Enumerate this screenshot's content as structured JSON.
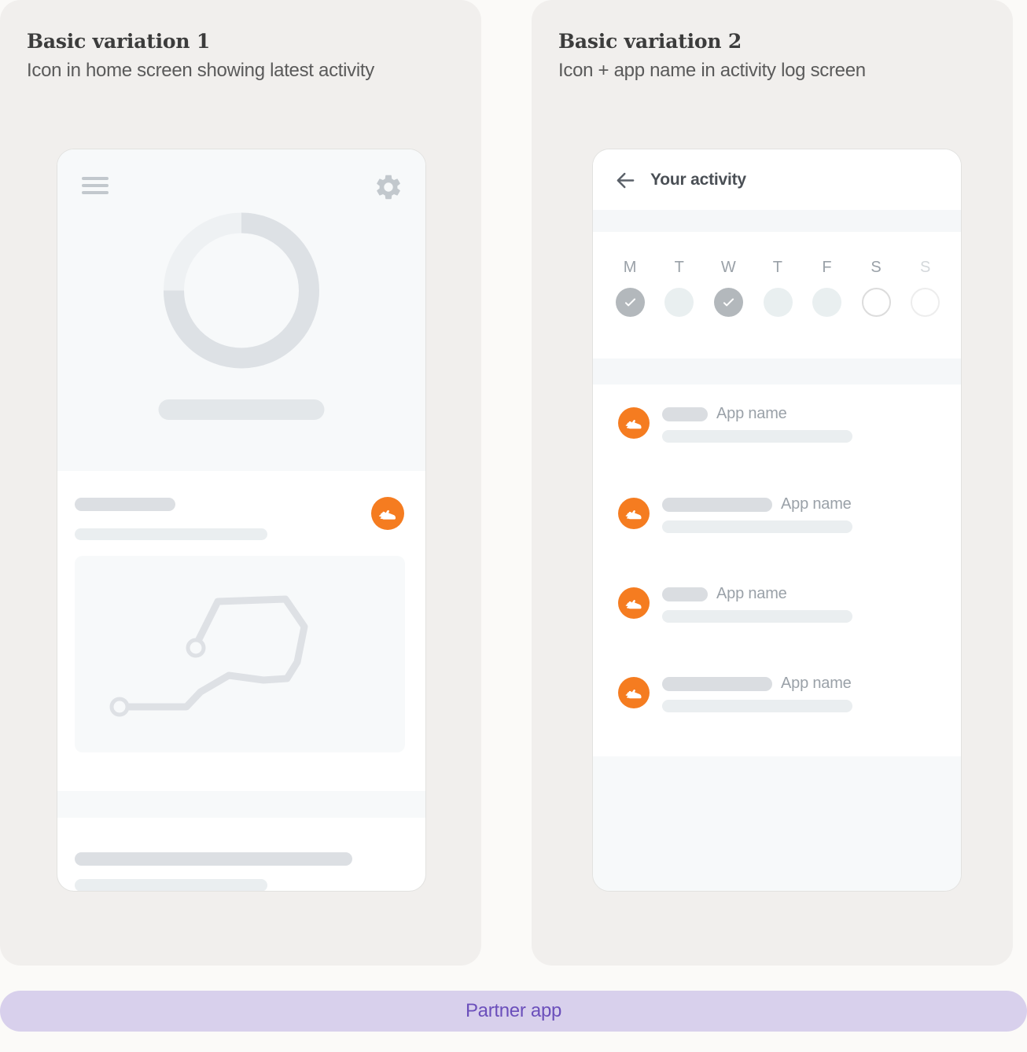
{
  "page": {
    "background_color": "#fbfaf8",
    "accent_orange": "#f57c20",
    "panel_color": "#f1efed"
  },
  "panels": [
    {
      "title": "Basic variation 1",
      "subtitle": "Icon in home screen showing latest activity"
    },
    {
      "title": "Basic variation 2",
      "subtitle": "Icon + app name in activity log screen"
    }
  ],
  "phone_home": {
    "menu_icon": "hamburger-menu-icon",
    "settings_icon": "gear-icon",
    "progress_ring": {
      "value_percent": 75,
      "track_color": "#eef1f3",
      "fill_color": "#dde1e5"
    },
    "badge_icon": "running-shoe-icon",
    "map_icon": "route-path-icon",
    "placeholders": {
      "hero_bar": "",
      "line_1": "",
      "line_2": "",
      "line_3": "",
      "line_4": ""
    }
  },
  "phone_activity": {
    "back_icon": "back-arrow-icon",
    "title": "Your activity",
    "week": {
      "days": [
        {
          "label": "M",
          "state": "done"
        },
        {
          "label": "T",
          "state": "filled"
        },
        {
          "label": "W",
          "state": "done"
        },
        {
          "label": "T",
          "state": "filled"
        },
        {
          "label": "F",
          "state": "filled"
        },
        {
          "label": "S",
          "state": "empty"
        },
        {
          "label": "S",
          "state": "empty-faint"
        }
      ]
    },
    "activities": [
      {
        "badge_icon": "running-shoe-icon",
        "chip_width": 58,
        "app_name": "App name",
        "sub_width": 242
      },
      {
        "badge_icon": "running-shoe-icon",
        "chip_width": 140,
        "app_name": "App name",
        "sub_width": 242
      },
      {
        "badge_icon": "running-shoe-icon",
        "chip_width": 58,
        "app_name": "App name",
        "sub_width": 242
      },
      {
        "badge_icon": "running-shoe-icon",
        "chip_width": 140,
        "app_name": "App name",
        "sub_width": 242
      }
    ]
  },
  "footer": {
    "label": "Partner app",
    "background_color": "#d8d0ec",
    "text_color": "#6b4fbb"
  }
}
